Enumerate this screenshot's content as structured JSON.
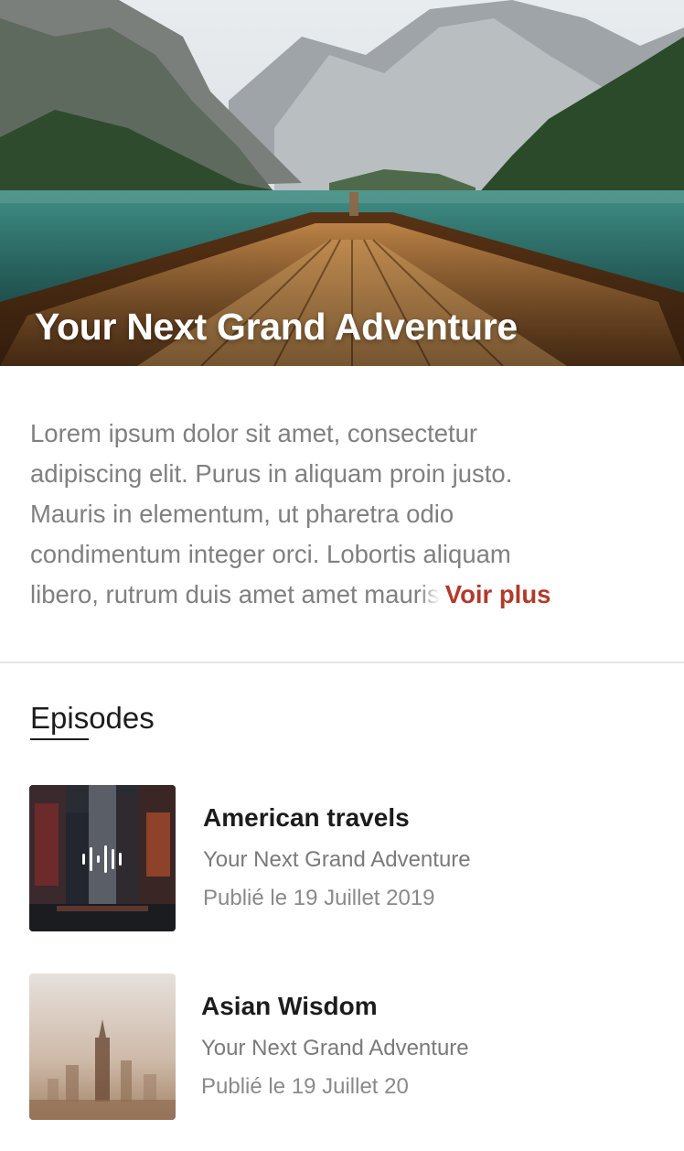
{
  "hero": {
    "title": "Your Next Grand Adventure"
  },
  "description": {
    "lines": [
      "Lorem ipsum dolor sit amet, consectetur",
      "adipiscing elit. Purus in aliquam proin justo.",
      "Mauris in elementum, ut pharetra odio",
      "condimentum integer orci. Lobortis aliquam",
      "libero, rutrum duis amet amet mauris"
    ],
    "more_label": "Voir plus"
  },
  "episodes_section": {
    "title": "Episodes",
    "items": [
      {
        "title": "American travels",
        "subtitle": "Your Next Grand Adventure",
        "date": "Publié le 19 Juillet 2019",
        "playing": true
      },
      {
        "title": "Asian Wisdom",
        "subtitle": "Your Next Grand Adventure",
        "date": "Publié le 19 Juillet 20",
        "playing": false
      }
    ]
  },
  "colors": {
    "accent": "#b23a2b",
    "text_primary": "#1c1c1c",
    "text_secondary": "#808080"
  },
  "icons": {
    "now_playing": "audio-wave-icon"
  }
}
